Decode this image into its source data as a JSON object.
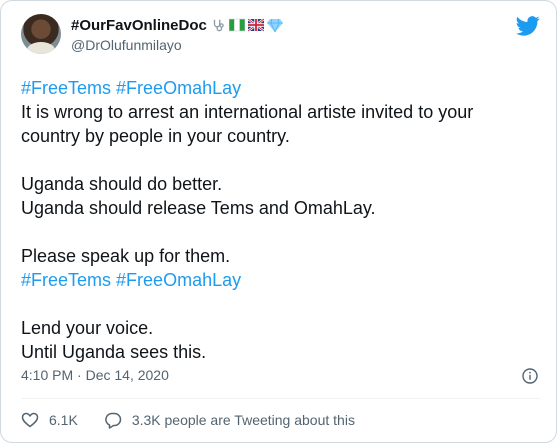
{
  "tweet": {
    "display_name": "#OurFavOnlineDoc",
    "name_emojis": [
      "stethoscope-icon",
      "nigeria-flag-icon",
      "uk-flag-icon",
      "diamond-icon"
    ],
    "handle": "@DrOlufunmilayo",
    "lines": [
      [
        {
          "t": "#FreeTems",
          "tag": true
        },
        {
          "t": " ",
          "tag": false
        },
        {
          "t": "#FreeOmahLay",
          "tag": true
        }
      ],
      [
        {
          "t": "It is wrong to arrest an international artiste invited to your",
          "tag": false
        }
      ],
      [
        {
          "t": "country by people in your country.",
          "tag": false
        }
      ],
      [],
      [
        {
          "t": "Uganda should do better.",
          "tag": false
        }
      ],
      [
        {
          "t": "Uganda should release Tems and OmahLay.",
          "tag": false
        }
      ],
      [],
      [
        {
          "t": "Please speak up for them.",
          "tag": false
        }
      ],
      [
        {
          "t": "#FreeTems",
          "tag": true
        },
        {
          "t": " ",
          "tag": false
        },
        {
          "t": "#FreeOmahLay",
          "tag": true
        }
      ],
      [],
      [
        {
          "t": "Lend your voice.",
          "tag": false
        }
      ],
      [
        {
          "t": "Until Uganda sees this.",
          "tag": false
        }
      ]
    ],
    "timestamp": "4:10 PM · Dec 14, 2020",
    "likes": "6.1K",
    "conversation": "3.3K people are Tweeting about this"
  },
  "colors": {
    "accent": "#1d9bf0",
    "muted": "#536471",
    "text": "#0f1419",
    "border": "#cfd9de"
  },
  "icons": {
    "brand": "twitter-bird-icon",
    "info": "info-icon",
    "like": "heart-icon",
    "reply": "speech-bubble-icon"
  }
}
